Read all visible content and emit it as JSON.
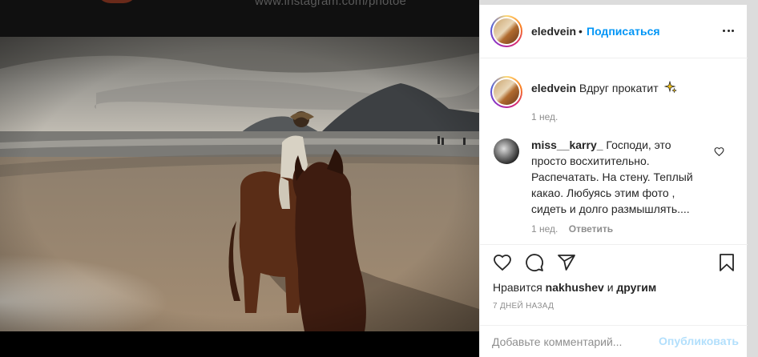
{
  "backdrop": {
    "url_text": "www.instagram.com/photoe"
  },
  "post": {
    "author": {
      "username": "eledvein",
      "separator": "•",
      "follow_label": "Подписаться"
    },
    "caption": {
      "username": "eledvein",
      "text": "Вдруг прокатит",
      "emoji": "sparkles-icon",
      "time": "1 нед."
    },
    "comments": [
      {
        "username": "miss__karry_",
        "text": "Господи, это просто восхитительно. Распечатать. На стену. Теплый какао. Любуясь этим фото , сидеть и долго размышлять....",
        "time": "1 нед.",
        "reply_label": "Ответить"
      }
    ],
    "likes": {
      "prefix": "Нравится",
      "user": "nakhushev",
      "conjunction": "и",
      "others": "другим"
    },
    "date": "7 ДНЕЙ НАЗАД",
    "comment_box": {
      "placeholder": "Добавьте комментарий...",
      "publish_label": "Опубликовать"
    }
  },
  "colors": {
    "link_blue": "#0095f6",
    "publish_disabled": "#b2dffc",
    "text_primary": "#262626",
    "text_secondary": "#8e8e8e"
  }
}
